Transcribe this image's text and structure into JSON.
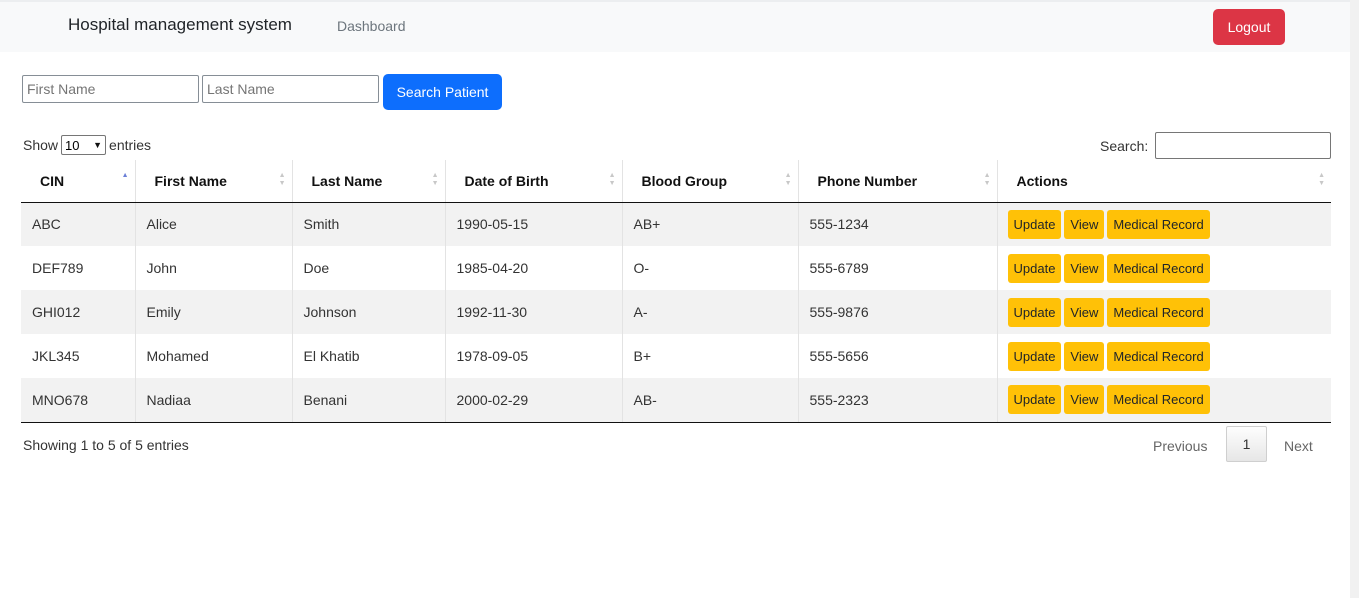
{
  "navbar": {
    "brand": "Hospital management system",
    "dashboard_link": "Dashboard",
    "logout_label": "Logout"
  },
  "search_form": {
    "first_name_placeholder": "First Name",
    "last_name_placeholder": "Last Name",
    "submit_label": "Search Patient"
  },
  "datatable": {
    "show_label": "Show",
    "entries_label": "entries",
    "page_length_value": "10",
    "search_label": "Search:",
    "columns": [
      "CIN",
      "First Name",
      "Last Name",
      "Date of Birth",
      "Blood Group",
      "Phone Number",
      "Actions"
    ],
    "sorted_column": "CIN",
    "sort_direction": "ascending",
    "action_labels": {
      "update": "Update",
      "view": "View",
      "medical_record": "Medical Record"
    },
    "rows": [
      {
        "cin": "ABC",
        "first_name": "Alice",
        "last_name": "Smith",
        "dob": "1990-05-15",
        "blood_group": "AB+",
        "phone": "555-1234"
      },
      {
        "cin": "DEF789",
        "first_name": "John",
        "last_name": "Doe",
        "dob": "1985-04-20",
        "blood_group": "O-",
        "phone": "555-6789"
      },
      {
        "cin": "GHI012",
        "first_name": "Emily",
        "last_name": "Johnson",
        "dob": "1992-11-30",
        "blood_group": "A-",
        "phone": "555-9876"
      },
      {
        "cin": "JKL345",
        "first_name": "Mohamed",
        "last_name": "El Khatib",
        "dob": "1978-09-05",
        "blood_group": "B+",
        "phone": "555-5656"
      },
      {
        "cin": "MNO678",
        "first_name": "Nadiaa",
        "last_name": "Benani",
        "dob": "2000-02-29",
        "blood_group": "AB-",
        "phone": "555-2323"
      }
    ],
    "info": "Showing 1 to 5 of 5 entries",
    "pagination": {
      "previous": "Previous",
      "current_page": "1",
      "next": "Next"
    }
  },
  "colors": {
    "primary": "#0d6efd",
    "danger": "#dc3545",
    "warning": "#ffc107",
    "navbar_bg": "#f8f9fa",
    "stripe": "#f2f2f2"
  },
  "icons": {
    "select_chevron": "chevron-down-icon",
    "sort_indicator": "sort-arrows-icon"
  }
}
